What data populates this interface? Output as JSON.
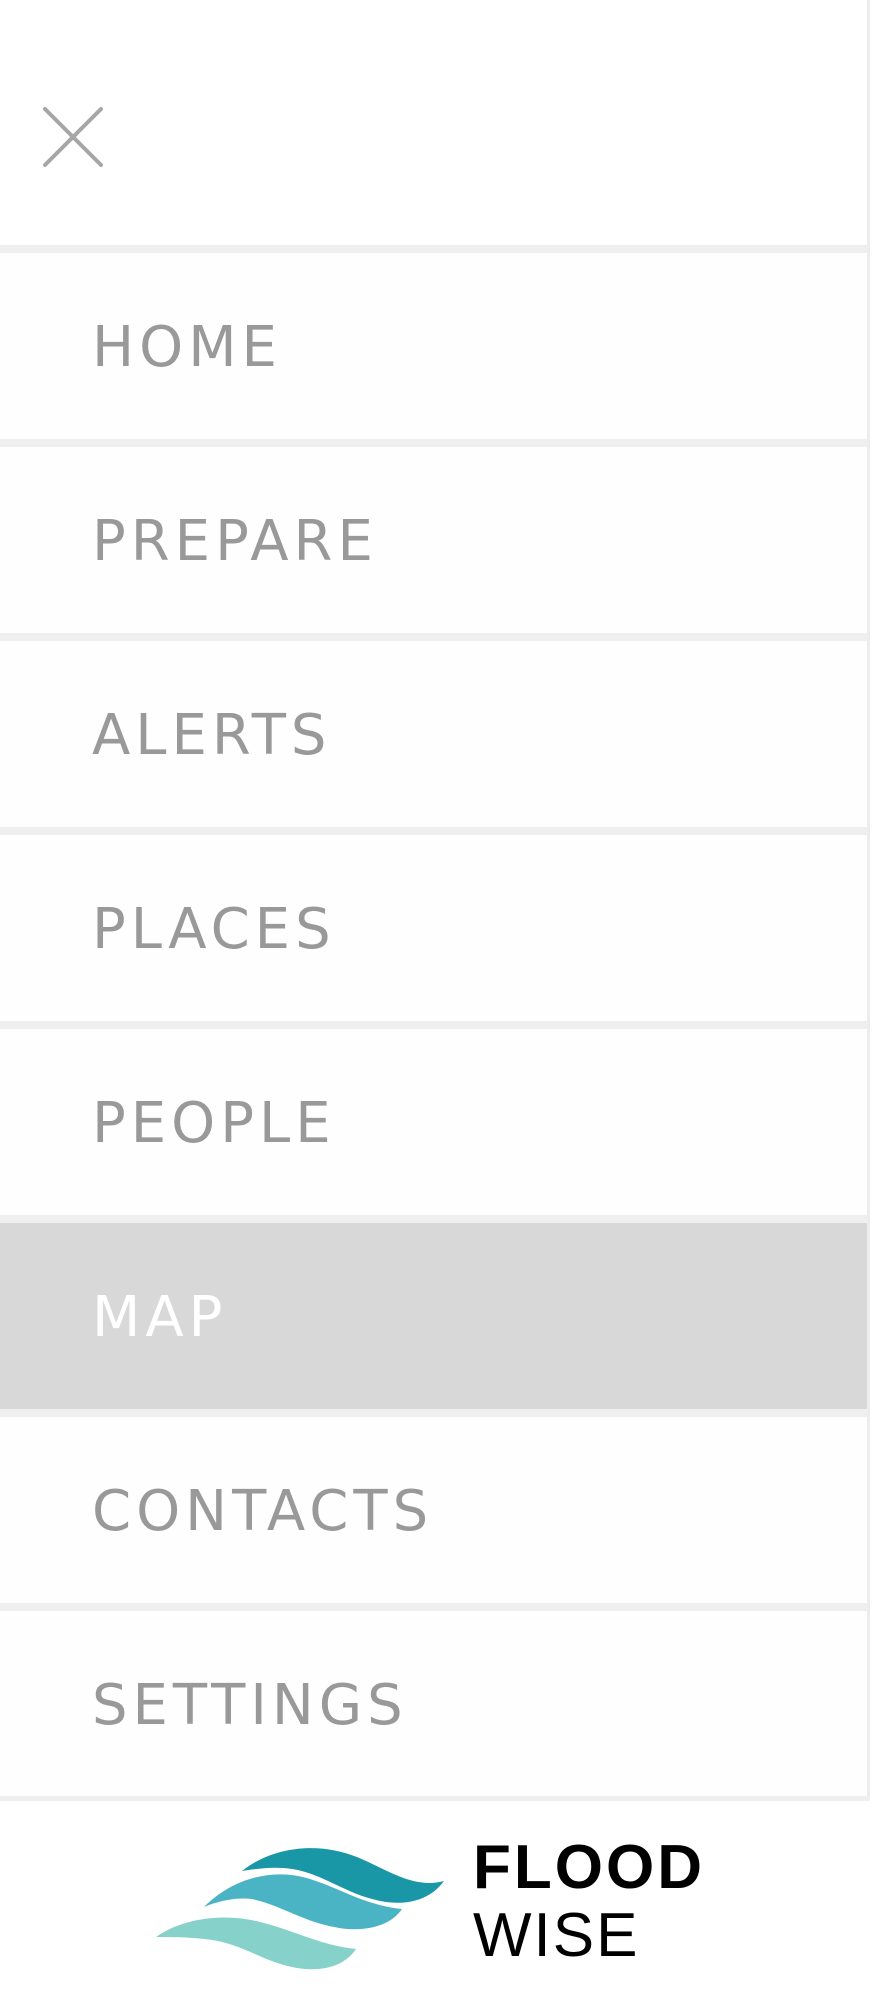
{
  "header": {
    "close_icon": "close-icon"
  },
  "nav": {
    "items": [
      {
        "label": "HOME",
        "active": false
      },
      {
        "label": "PREPARE",
        "active": false
      },
      {
        "label": "ALERTS",
        "active": false
      },
      {
        "label": "PLACES",
        "active": false
      },
      {
        "label": "PEOPLE",
        "active": false
      },
      {
        "label": "MAP",
        "active": true
      },
      {
        "label": "CONTACTS",
        "active": false
      },
      {
        "label": "SETTINGS",
        "active": false
      }
    ]
  },
  "footer": {
    "logo_icon": "wave-logo-icon",
    "logo_line1": "FLOOD",
    "logo_line2": "WISE"
  },
  "colors": {
    "nav_text": "#999999",
    "active_bg": "#d8d8d8",
    "active_text": "#ffffff",
    "divider": "#efefef",
    "wave_dark": "#1a97a6",
    "wave_mid": "#4ab4c4",
    "wave_light": "#86d2ca"
  }
}
